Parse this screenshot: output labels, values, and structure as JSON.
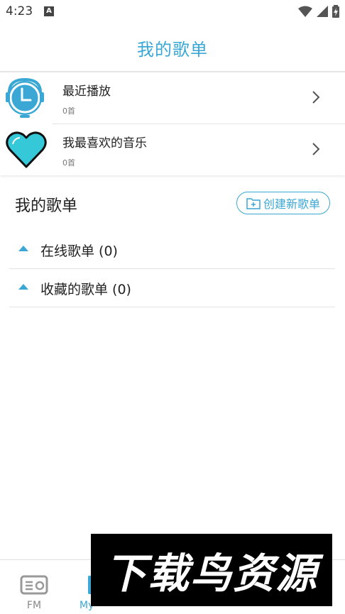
{
  "status_bar": {
    "time": "4:23",
    "a_badge": "A"
  },
  "header": {
    "title": "我的歌单"
  },
  "recent": [
    {
      "title": "最近播放",
      "count": "0首",
      "icon": "clock-icon"
    },
    {
      "title": "我最喜欢的音乐",
      "count": "0首",
      "icon": "heart-icon"
    }
  ],
  "section": {
    "title": "我的歌单",
    "create_label": "创建新歌单"
  },
  "groups": [
    {
      "label": "在线歌单 (0)"
    },
    {
      "label": "收藏的歌单 (0)"
    }
  ],
  "bottom_nav": {
    "fm_label": "FM",
    "my_label": "My"
  },
  "watermark": {
    "text": "下载鸟资源"
  },
  "colors": {
    "accent": "#3aa7d5",
    "heart": "#35c8d9"
  }
}
